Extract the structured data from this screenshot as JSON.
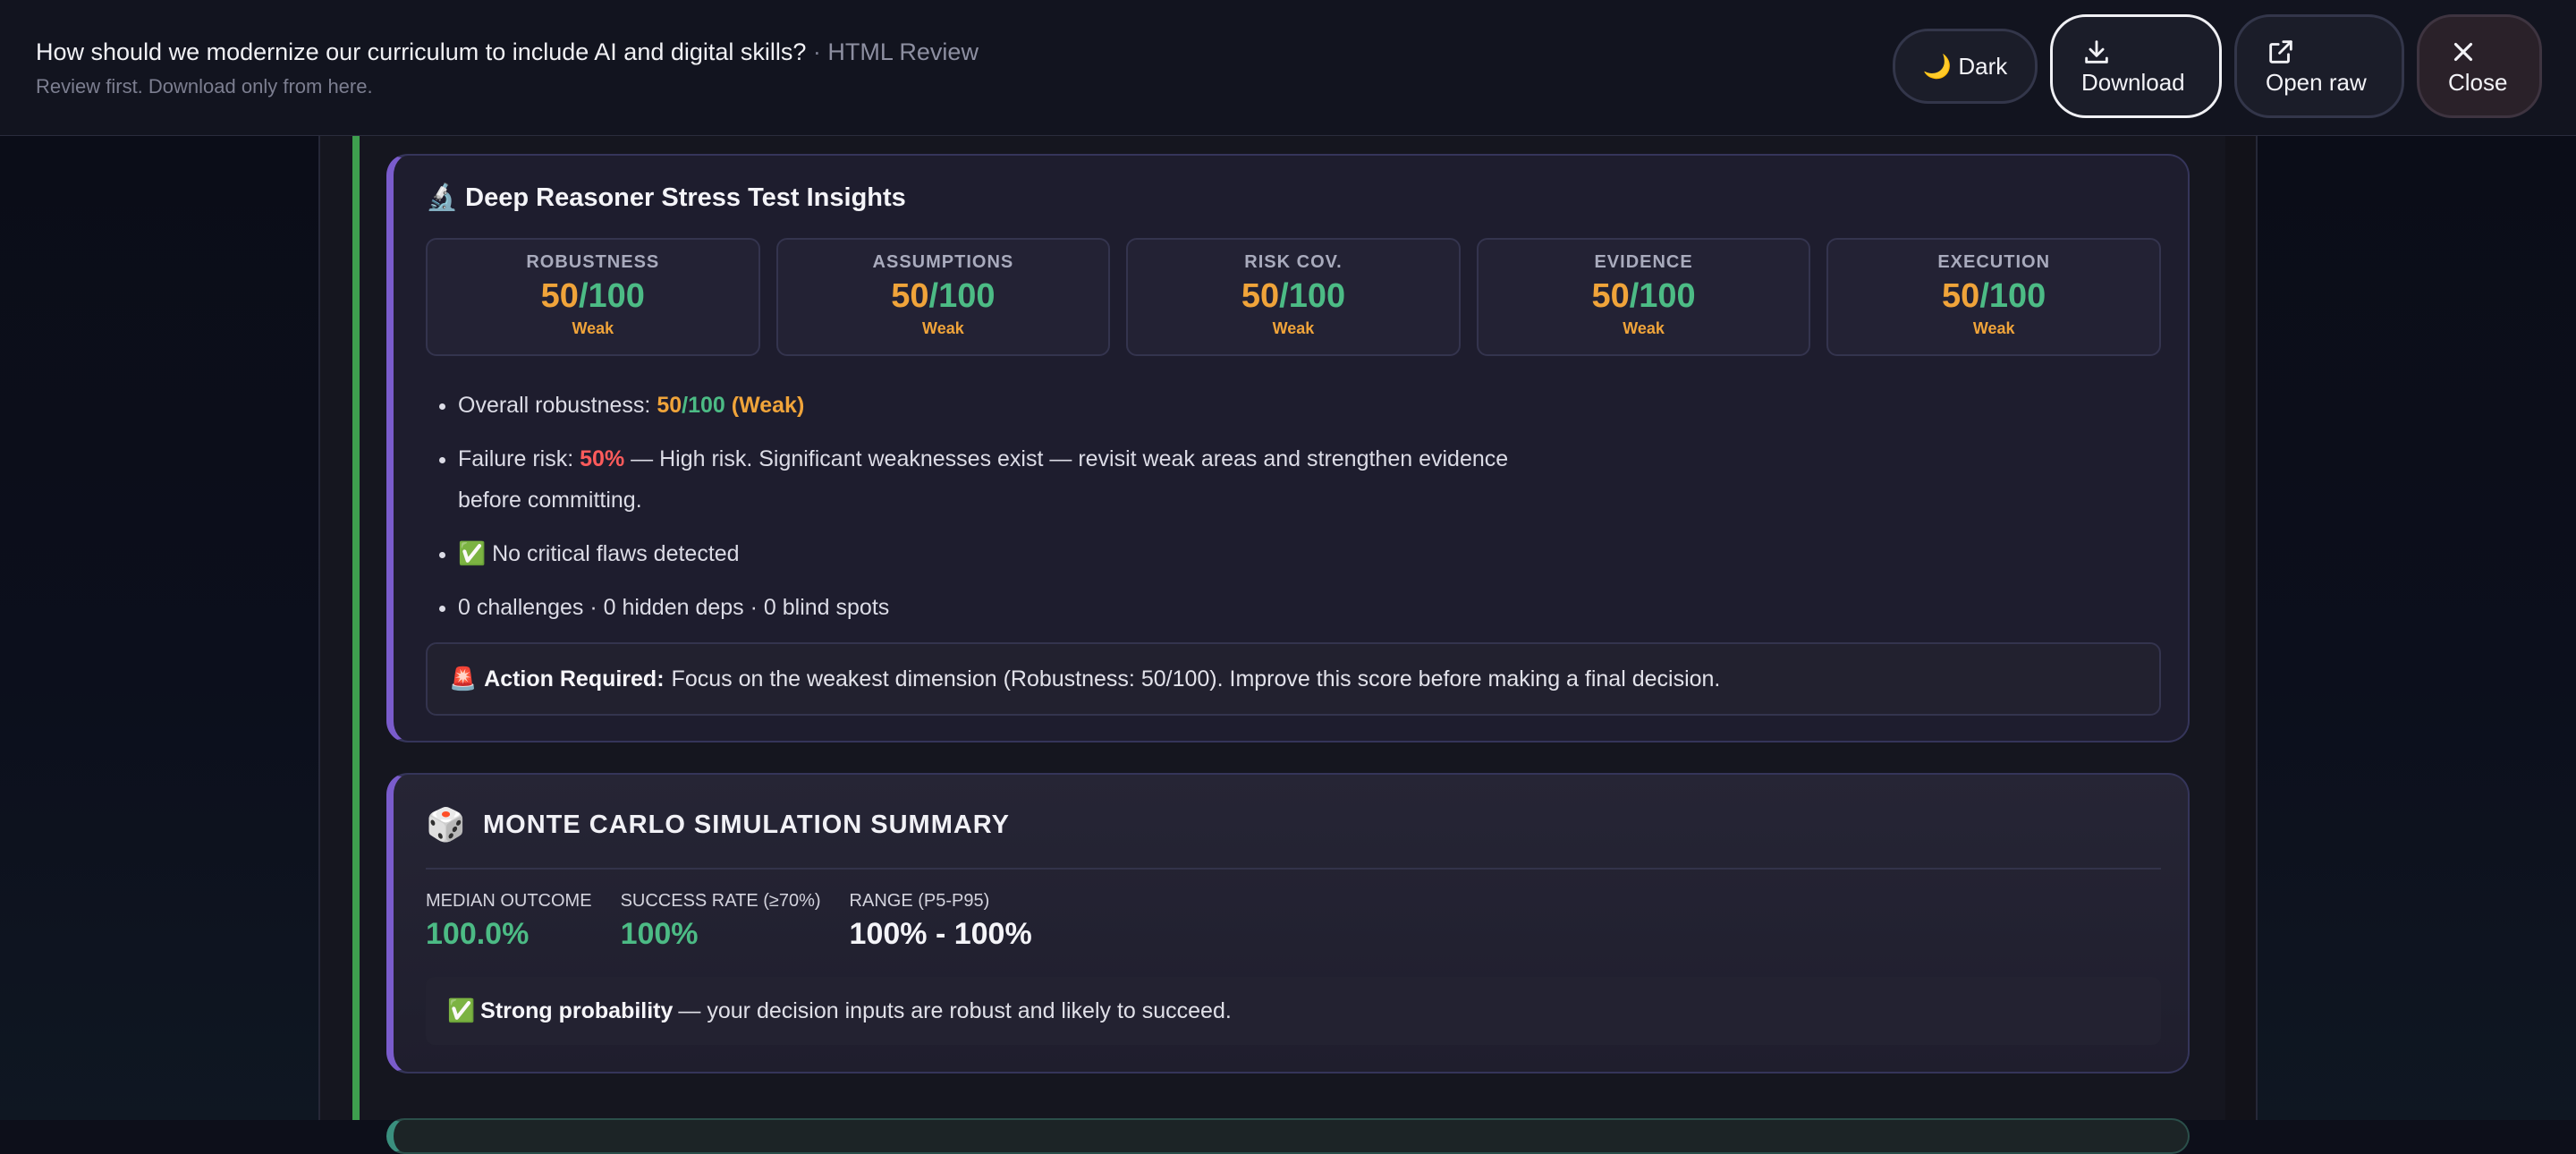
{
  "header": {
    "title": "How should we modernize our curriculum to include AI and digital skills?",
    "separator": " · ",
    "title_suffix": "HTML Review",
    "subtitle": "Review first. Download only from here.",
    "buttons": {
      "dark": "🌙 Dark",
      "download": "Download",
      "open_raw": "Open raw",
      "close": "Close"
    }
  },
  "stress_test": {
    "title": "🔬 Deep Reasoner Stress Test Insights",
    "metrics": [
      {
        "label": "ROBUSTNESS",
        "score": "50",
        "max": "/100",
        "rating": "Weak"
      },
      {
        "label": "ASSUMPTIONS",
        "score": "50",
        "max": "/100",
        "rating": "Weak"
      },
      {
        "label": "RISK COV.",
        "score": "50",
        "max": "/100",
        "rating": "Weak"
      },
      {
        "label": "EVIDENCE",
        "score": "50",
        "max": "/100",
        "rating": "Weak"
      },
      {
        "label": "EXECUTION",
        "score": "50",
        "max": "/100",
        "rating": "Weak"
      }
    ],
    "overall_label": "Overall robustness: ",
    "overall_score": "50",
    "overall_max": "/100",
    "overall_rating": " (Weak)",
    "failure_label": "Failure risk: ",
    "failure_value": "50%",
    "failure_text": " — High risk. Significant weaknesses exist — revisit weak areas and strengthen evidence before committing.",
    "no_flaws": "✅ No critical flaws detected",
    "counts": "0 challenges · 0 hidden deps · 0 blind spots",
    "action_icon": "🚨",
    "action_label": "Action Required:",
    "action_text": "Focus on the weakest dimension (Robustness: 50/100). Improve this score before making a final decision."
  },
  "monte_carlo": {
    "icon": "🎲",
    "title": "MONTE CARLO SIMULATION SUMMARY",
    "stats": [
      {
        "label": "MEDIAN OUTCOME",
        "value": "100.0%",
        "tone": "green"
      },
      {
        "label": "SUCCESS RATE (≥70%)",
        "value": "100%",
        "tone": "green"
      },
      {
        "label": "RANGE (P5-P95)",
        "value": "100% - 100%",
        "tone": "white"
      }
    ],
    "note_icon": "✅",
    "note_label": "Strong probability",
    "note_text": "— your decision inputs are robust and likely to succeed."
  },
  "colors": {
    "accent": "#7a5ccc",
    "score": "#f0a43a",
    "good": "#4cbb85",
    "danger": "#ff5b5b",
    "green_bar": "#3e9e4e"
  }
}
